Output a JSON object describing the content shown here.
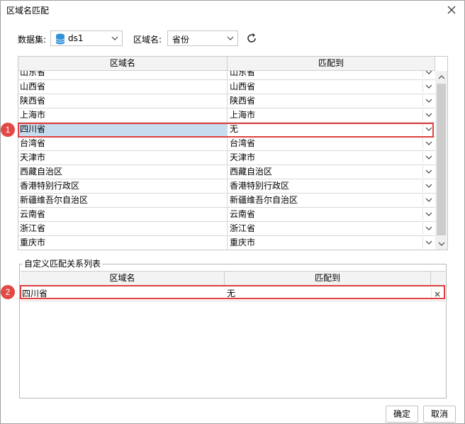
{
  "window": {
    "title": "区域名匹配"
  },
  "toolbar": {
    "dataset_label": "数据集:",
    "dataset_value": "ds1",
    "region_label": "区域名:",
    "region_value": "省份"
  },
  "table1": {
    "headers": [
      "区域名",
      "匹配到"
    ],
    "rows": [
      {
        "name": "山东省",
        "match": "山东省"
      },
      {
        "name": "山西省",
        "match": "山西省"
      },
      {
        "name": "陕西省",
        "match": "陕西省"
      },
      {
        "name": "上海市",
        "match": "上海市"
      },
      {
        "name": "四川省",
        "match": "无"
      },
      {
        "name": "台湾省",
        "match": "台湾省"
      },
      {
        "name": "天津市",
        "match": "天津市"
      },
      {
        "name": "西藏自治区",
        "match": "西藏自治区"
      },
      {
        "name": "香港特别行政区",
        "match": "香港特别行政区"
      },
      {
        "name": "新疆维吾尔自治区",
        "match": "新疆维吾尔自治区"
      },
      {
        "name": "云南省",
        "match": "云南省"
      },
      {
        "name": "浙江省",
        "match": "浙江省"
      },
      {
        "name": "重庆市",
        "match": "重庆市"
      }
    ]
  },
  "custom": {
    "title": "自定义匹配关系列表",
    "headers": [
      "区域名",
      "匹配到"
    ],
    "rows": [
      {
        "name": "四川省",
        "match": "无"
      }
    ]
  },
  "badges": [
    "1",
    "2"
  ],
  "buttons": {
    "ok": "确定",
    "cancel": "取消"
  },
  "colors": {
    "highlight": "#e0403f",
    "selected_row": "#c6dcef",
    "db_icon": "#2e8fd8"
  }
}
